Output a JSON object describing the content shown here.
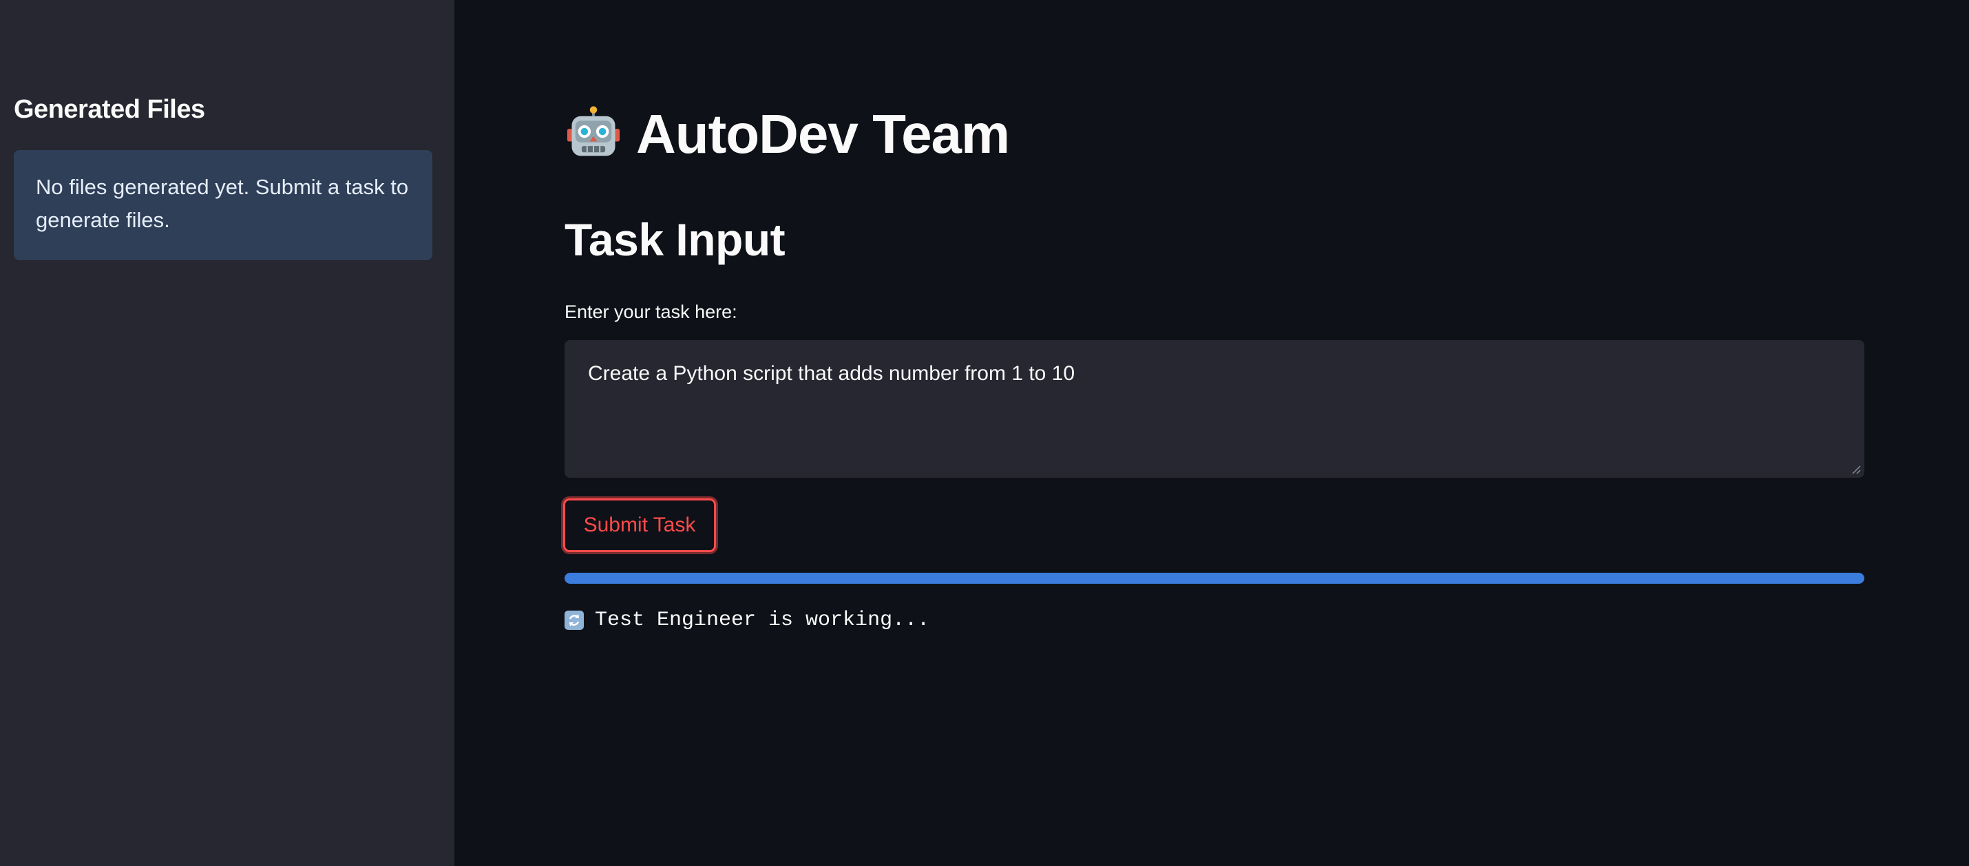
{
  "sidebar": {
    "header": "Generated Files",
    "info_message": "No files generated yet. Submit a task to generate files."
  },
  "main": {
    "title_icon": "robot-icon",
    "title": "AutoDev Team",
    "section_title": "Task Input",
    "task_input": {
      "label": "Enter your task here:",
      "value": "Create a Python script that adds number from 1 to 10"
    },
    "submit_label": "Submit Task",
    "progress": 1.0,
    "status_icon": "refresh-icon",
    "status_text": "Test Engineer is working..."
  },
  "colors": {
    "app_background": "#0e1117",
    "sidebar_background": "#262730",
    "info_background": "#2f3f58",
    "accent": "#ff4b4b",
    "progress": "#3b7ddd",
    "text": "#fafafa"
  }
}
